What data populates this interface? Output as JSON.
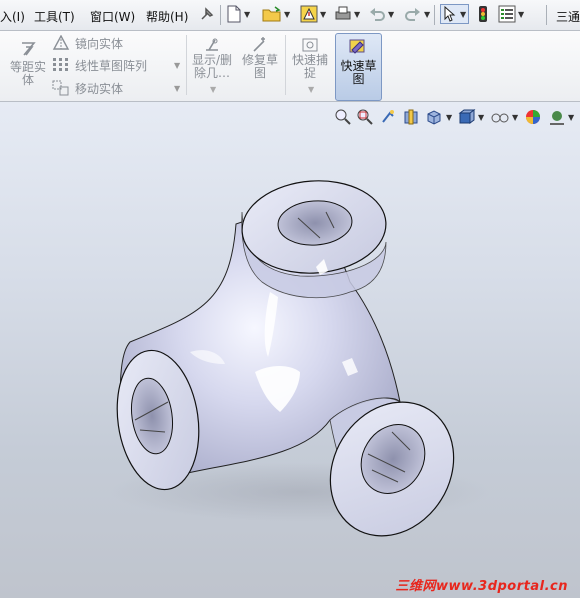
{
  "menubar": {
    "items": [
      "入(I)",
      "工具(T)",
      "窗口(W)",
      "帮助(H)"
    ],
    "right_label": "三通"
  },
  "ribbon": {
    "offset_entities": "等距实体",
    "mirror_entities": "镜向实体",
    "linear_pattern": "线性草图阵列",
    "move_entities": "移动实体",
    "display_delete": "显示/删除几…",
    "repair_sketch": "修复草图",
    "quick_snaps": "快速捕捉",
    "quick_sketch": "快速草图"
  },
  "viewport": {
    "model": "three-way tube junction (三通)"
  },
  "watermark": {
    "brand": "三维网",
    "url": "www.3dportal.cn"
  },
  "colors": {
    "accent": "#7d98c4",
    "watermark": "#e8261d",
    "model_body": "#d4d6ec",
    "model_shadow": "#a8abc9"
  }
}
